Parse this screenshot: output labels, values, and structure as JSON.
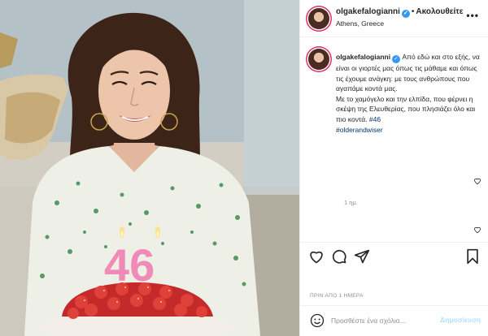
{
  "post": {
    "username": "olgakefalogianni",
    "verified": true,
    "follow_separator": "•",
    "follow_label": "Ακολουθείτε",
    "location": "Athens, Greece",
    "more_label": "•••",
    "photo_alt": "",
    "cake_candles": "46"
  },
  "caption": {
    "username": "olgakefalogianni",
    "line1": "Από εδώ και στο εξής, να είναι οι γιορτές μας όπως τις μάθαμε και όπως τις έχουμε ανάγκη: με τους ανθρώπους που αγαπάμε κοντά μας.",
    "line2": "Με το χαμόγελο και την ελπίδα, που φέρνει η σκέψη της Ελευθερίας, που πλησιάζει όλο και πιο κοντά.",
    "tag1": "#46",
    "tag2": "#olderandwiser",
    "time": "1 ημ."
  },
  "footer": {
    "timestamp": "ΠΡΙΝ ΑΠΟ 1 ΗΜΕΡΑ",
    "comment_placeholder": "Προσθέστε ένα σχόλιο...",
    "post_label": "Δημοσίευση"
  },
  "icons": {
    "like": "heart-icon",
    "comment": "comment-icon",
    "share": "share-icon",
    "save": "bookmark-icon",
    "emoji": "emoji-icon",
    "more": "more-options-icon"
  },
  "colors": {
    "link": "#00376b",
    "verified": "#3897f0",
    "post_button_disabled": "#b2dffc",
    "meta_gray": "#8e8e8e"
  }
}
